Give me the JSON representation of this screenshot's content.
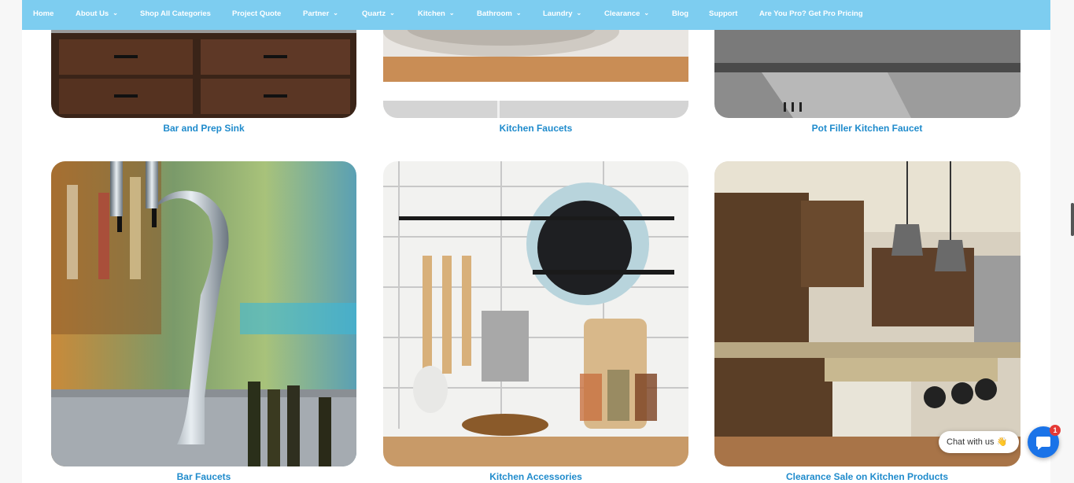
{
  "nav": {
    "items": [
      {
        "label": "Home",
        "dropdown": false
      },
      {
        "label": "About Us",
        "dropdown": true
      },
      {
        "label": "Shop All Categories",
        "dropdown": false
      },
      {
        "label": "Project Quote",
        "dropdown": false
      },
      {
        "label": "Partner",
        "dropdown": true
      },
      {
        "label": "Quartz",
        "dropdown": true
      },
      {
        "label": "Kitchen",
        "dropdown": true
      },
      {
        "label": "Bathroom",
        "dropdown": true
      },
      {
        "label": "Laundry",
        "dropdown": true
      },
      {
        "label": "Clearance",
        "dropdown": true
      },
      {
        "label": "Blog",
        "dropdown": false
      },
      {
        "label": "Support",
        "dropdown": false
      },
      {
        "label": "Are You Pro? Get Pro Pricing",
        "dropdown": false
      }
    ],
    "chevron": "⌄"
  },
  "tiles": {
    "row1": [
      {
        "label": "Bar and Prep Sink"
      },
      {
        "label": "Kitchen Faucets"
      },
      {
        "label": "Pot Filler Kitchen Faucet"
      }
    ],
    "row2": [
      {
        "label": "Bar Faucets"
      },
      {
        "label": "Kitchen Accessories"
      },
      {
        "label": "Clearance Sale on Kitchen Products"
      }
    ]
  },
  "chat": {
    "label": "Chat with us 👋",
    "badge": "1"
  },
  "colors": {
    "nav_bg": "#7dcdf0",
    "link": "#1f8bcc",
    "chat": "#1a73e8",
    "badge": "#e53935"
  }
}
